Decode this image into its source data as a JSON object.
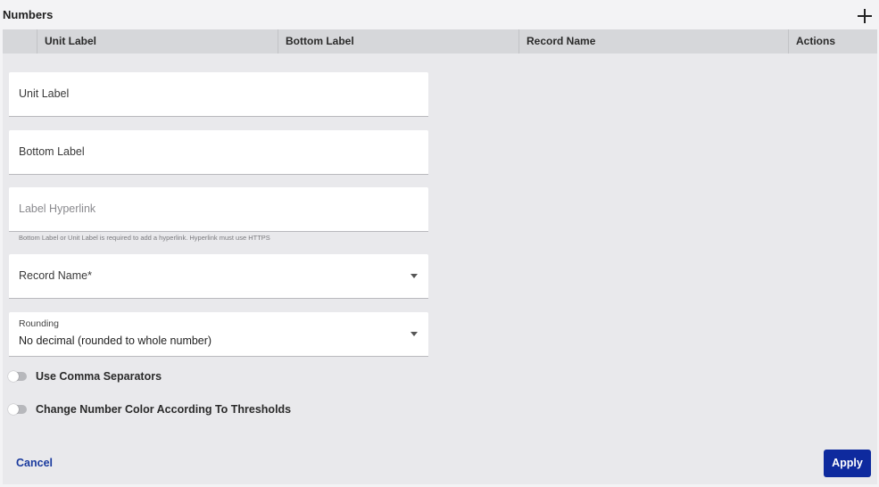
{
  "section": {
    "title": "Numbers",
    "add_icon": "plus-icon"
  },
  "table": {
    "columns": [
      "Unit Label",
      "Bottom Label",
      "Record Name",
      "Actions"
    ]
  },
  "form": {
    "unit_label": {
      "placeholder": "Unit Label"
    },
    "bottom_label": {
      "placeholder": "Bottom Label"
    },
    "label_hyperlink": {
      "placeholder": "Label Hyperlink",
      "disabled": true,
      "helper": "Bottom Label or Unit Label is required to add a hyperlink. Hyperlink must use HTTPS"
    },
    "record_name": {
      "placeholder": "Record Name*",
      "icon": "caret-down-icon"
    },
    "rounding": {
      "label": "Rounding",
      "value": "No decimal (rounded to whole number)",
      "icon": "caret-down-icon"
    },
    "toggles": [
      {
        "label": "Use Comma Separators",
        "on": false
      },
      {
        "label": "Change Number Color According To Thresholds",
        "on": false
      }
    ]
  },
  "actions": {
    "cancel_label": "Cancel",
    "apply_label": "Apply"
  },
  "colors": {
    "primary": "#0e2a9e",
    "link": "#1a3a9e",
    "panel_bg": "#e9e9ec",
    "header_bg": "#d6d7da"
  }
}
